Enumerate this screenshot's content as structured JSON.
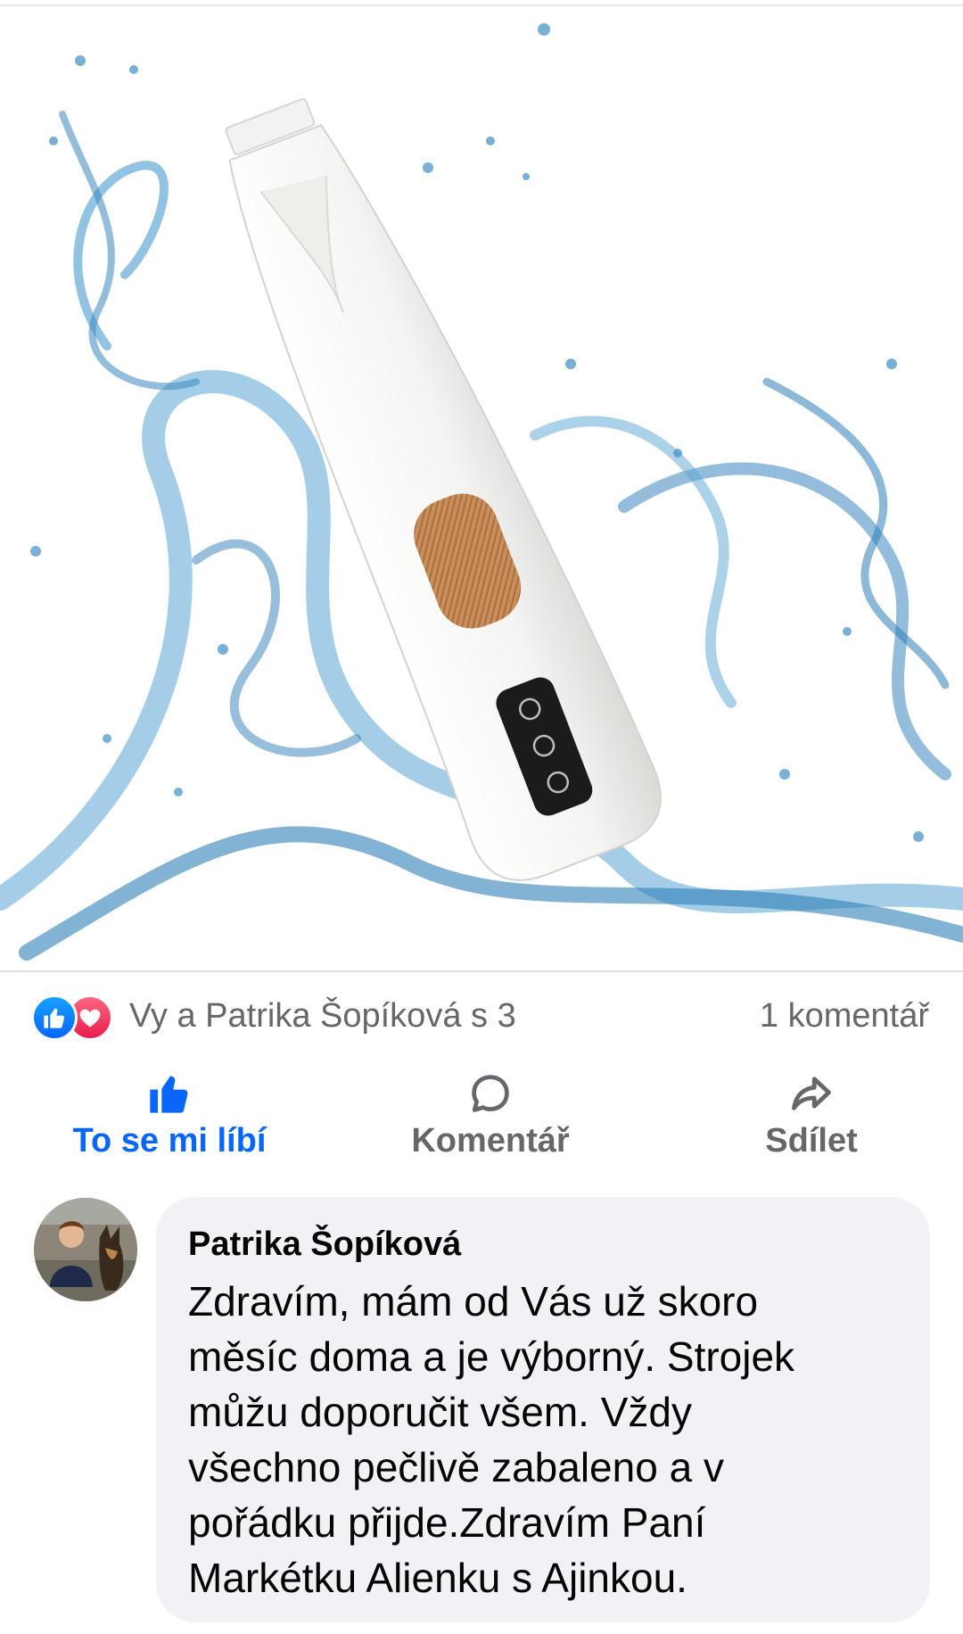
{
  "post": {
    "image_subject": "Pet hair trimmer with water splash"
  },
  "reactions": {
    "icons": [
      "like-icon",
      "love-icon"
    ],
    "summary": "Vy a Patrika Šopíková s 3",
    "comment_count": "1 komentář"
  },
  "actions": {
    "like_label": "To se mi líbí",
    "comment_label": "Komentář",
    "share_label": "Sdílet"
  },
  "comment": {
    "author": "Patrika Šopíková",
    "lines": [
      "Zdravím, mám od Vás už skoro",
      "měsíc doma a je výborný. Strojek",
      "můžu doporučit všem. Vždy",
      "všechno pečlivě zabaleno a v",
      "pořádku přijde.Zdravím Paní",
      "Markétku Alienku s Ajinkou."
    ]
  },
  "colors": {
    "accent": "#0866ff",
    "secondary_text": "#65676b",
    "bubble": "#f0f2f5",
    "love": "#e61e4d",
    "trimmer_button": "#c98e5c"
  }
}
